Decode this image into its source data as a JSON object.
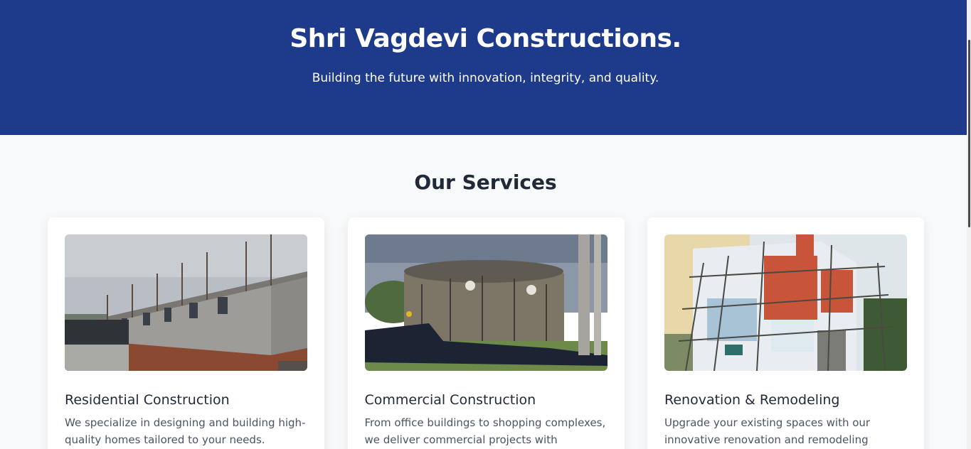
{
  "hero": {
    "title": "Shri Vagdevi Constructions.",
    "tagline": "Building the future with innovation, integrity, and quality."
  },
  "services": {
    "heading": "Our Services",
    "items": [
      {
        "title": "Residential Construction",
        "description": "We specialize in designing and building high-quality homes tailored to your needs."
      },
      {
        "title": "Commercial Construction",
        "description": "From office buildings to shopping complexes, we deliver commercial projects with precision."
      },
      {
        "title": "Renovation & Remodeling",
        "description": "Upgrade your existing spaces with our innovative renovation and remodeling solutions."
      }
    ]
  },
  "colors": {
    "hero_bg": "#1e3a8a",
    "page_bg": "#f8f9fb",
    "card_bg": "#ffffff"
  }
}
